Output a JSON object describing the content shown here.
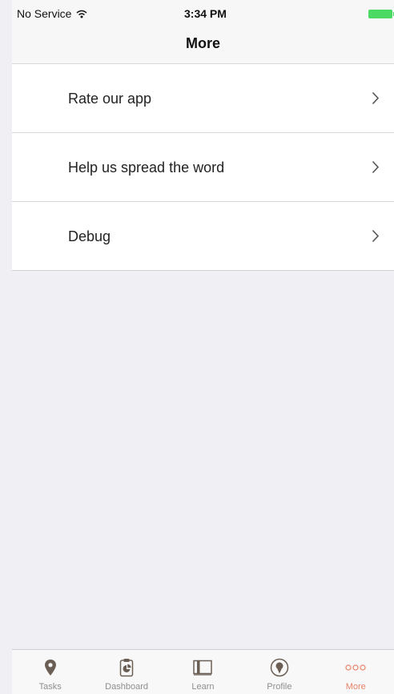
{
  "status_bar": {
    "carrier": "No Service",
    "time": "3:34 PM"
  },
  "nav": {
    "title": "More"
  },
  "menu": {
    "items": [
      {
        "label": "Rate our app"
      },
      {
        "label": "Help us spread the word"
      },
      {
        "label": "Debug"
      }
    ]
  },
  "tabbar": {
    "active": "More",
    "active_color": "#e8836a",
    "tabs": [
      {
        "label": "Tasks",
        "icon": "map-pin-icon"
      },
      {
        "label": "Dashboard",
        "icon": "clipboard-chart-icon"
      },
      {
        "label": "Learn",
        "icon": "book-icon"
      },
      {
        "label": "Profile",
        "icon": "profile-icon"
      },
      {
        "label": "More",
        "icon": "more-dots-icon"
      }
    ]
  }
}
